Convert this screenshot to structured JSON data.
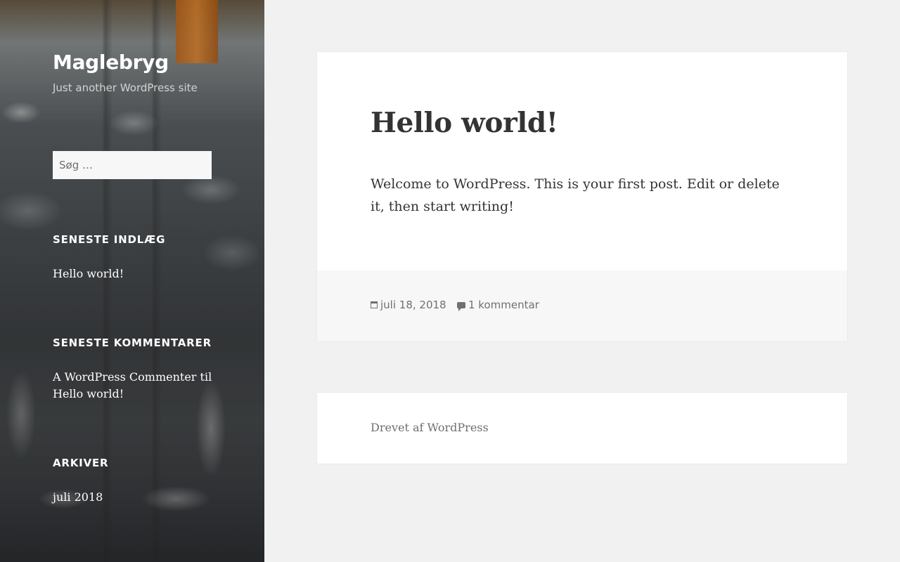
{
  "site": {
    "title": "Maglebryg",
    "description": "Just another WordPress site"
  },
  "search": {
    "placeholder": "Søg …"
  },
  "widgets": {
    "recent_posts": {
      "title": "SENESTE INDLÆG",
      "items": [
        "Hello world!"
      ]
    },
    "recent_comments": {
      "title": "SENESTE KOMMENTARER",
      "items": [
        "A WordPress Commenter til Hello world!"
      ]
    },
    "archives": {
      "title": "ARKIVER",
      "items": [
        "juli 2018"
      ]
    }
  },
  "post": {
    "title": "Hello world!",
    "body": "Welcome to WordPress. This is your first post. Edit or delete it, then start writing!",
    "date": "juli 18, 2018",
    "comments": "1 kommentar"
  },
  "footer": {
    "credit": "Drevet af WordPress"
  },
  "icons": {
    "date": "calendar-icon",
    "comments": "comment-bubble-icon"
  },
  "colors": {
    "background": "#f1f1f1",
    "card": "#ffffff",
    "text": "#333333",
    "meta": "#707070"
  }
}
